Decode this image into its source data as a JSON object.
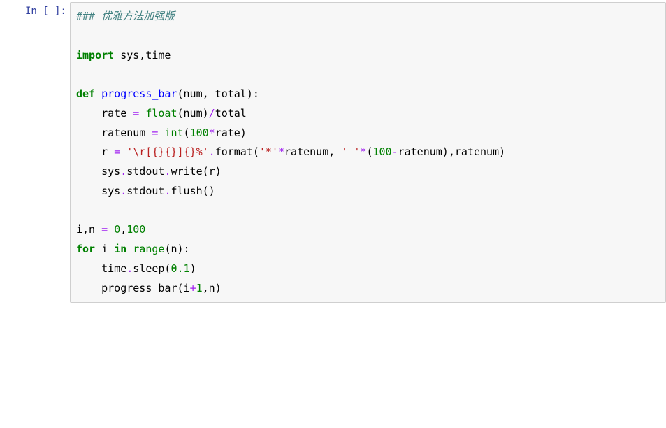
{
  "cells": [
    {
      "prompt_label": "In [ ]:",
      "prompt_number": "",
      "code_tokens": [
        [
          [
            "comment",
            "### 优雅方法加强版"
          ]
        ],
        [],
        [
          [
            "keyword",
            "import"
          ],
          [
            "text",
            " sys,time"
          ]
        ],
        [],
        [
          [
            "keyword",
            "def"
          ],
          [
            "text",
            " "
          ],
          [
            "funcdef",
            "progress_bar"
          ],
          [
            "text",
            "(num, total):"
          ]
        ],
        [
          [
            "text",
            "    rate "
          ],
          [
            "op",
            "="
          ],
          [
            "text",
            " "
          ],
          [
            "builtin",
            "float"
          ],
          [
            "text",
            "(num)"
          ],
          [
            "op",
            "/"
          ],
          [
            "text",
            "total"
          ]
        ],
        [
          [
            "text",
            "    ratenum "
          ],
          [
            "op",
            "="
          ],
          [
            "text",
            " "
          ],
          [
            "builtin",
            "int"
          ],
          [
            "text",
            "("
          ],
          [
            "number",
            "100"
          ],
          [
            "op",
            "*"
          ],
          [
            "text",
            "rate)"
          ]
        ],
        [
          [
            "text",
            "    r "
          ],
          [
            "op",
            "="
          ],
          [
            "text",
            " "
          ],
          [
            "string",
            "'\\r[{}{}]{}%'"
          ],
          [
            "op",
            "."
          ],
          [
            "text",
            "format("
          ],
          [
            "string",
            "'*'"
          ],
          [
            "op",
            "*"
          ],
          [
            "text",
            "ratenum, "
          ],
          [
            "string",
            "' '"
          ],
          [
            "op",
            "*"
          ],
          [
            "text",
            "("
          ],
          [
            "number",
            "100"
          ],
          [
            "op",
            "-"
          ],
          [
            "text",
            "ratenum),ratenum)"
          ]
        ],
        [
          [
            "text",
            "    sys"
          ],
          [
            "op",
            "."
          ],
          [
            "text",
            "stdout"
          ],
          [
            "op",
            "."
          ],
          [
            "text",
            "write(r)"
          ]
        ],
        [
          [
            "text",
            "    sys"
          ],
          [
            "op",
            "."
          ],
          [
            "text",
            "stdout"
          ],
          [
            "op",
            "."
          ],
          [
            "text",
            "flush()"
          ]
        ],
        [],
        [
          [
            "text",
            "i,n "
          ],
          [
            "op",
            "="
          ],
          [
            "text",
            " "
          ],
          [
            "number",
            "0"
          ],
          [
            "text",
            ","
          ],
          [
            "number",
            "100"
          ]
        ],
        [
          [
            "keyword",
            "for"
          ],
          [
            "text",
            " i "
          ],
          [
            "keyword",
            "in"
          ],
          [
            "text",
            " "
          ],
          [
            "builtin",
            "range"
          ],
          [
            "text",
            "(n):"
          ]
        ],
        [
          [
            "text",
            "    time"
          ],
          [
            "op",
            "."
          ],
          [
            "text",
            "sleep("
          ],
          [
            "number",
            "0.1"
          ],
          [
            "text",
            ")"
          ]
        ],
        [
          [
            "text",
            "    progress_bar(i"
          ],
          [
            "op",
            "+"
          ],
          [
            "number",
            "1"
          ],
          [
            "text",
            ",n)"
          ]
        ]
      ]
    }
  ],
  "output_prompt": ""
}
